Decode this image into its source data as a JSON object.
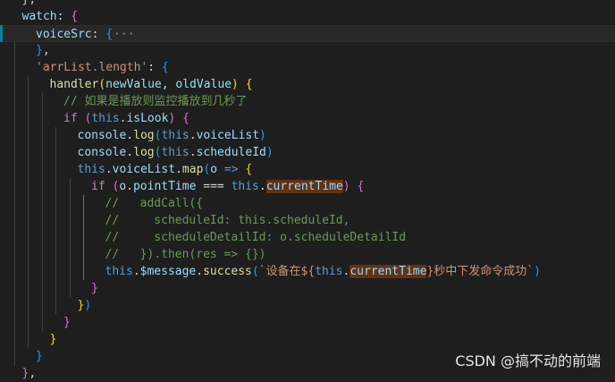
{
  "colors": {
    "background": "#1e1e1e",
    "current_line": "#282828",
    "modified_marker": "#0c7d9d",
    "word_highlight": "#613214"
  },
  "code_lines": [
    {
      "indent": 1,
      "segments": [
        {
          "t": "},",
          "c": "#d4d4d4"
        }
      ]
    },
    {
      "indent": 1,
      "segments": [
        {
          "t": "watch",
          "c": "#9cdcfe"
        },
        {
          "t": ": ",
          "c": "#d4d4d4"
        },
        {
          "t": "{",
          "c": "#da70d6"
        }
      ]
    },
    {
      "indent": 2,
      "current": true,
      "segments": [
        {
          "t": "voiceSrc",
          "c": "#9cdcfe"
        },
        {
          "t": ": ",
          "c": "#d4d4d4"
        },
        {
          "t": "{",
          "c": "#179fff"
        },
        {
          "t": "···",
          "c": "#8a8a8a",
          "fold": true
        }
      ]
    },
    {
      "indent": 2,
      "segments": [
        {
          "t": "}",
          "c": "#179fff"
        },
        {
          "t": ",",
          "c": "#d4d4d4"
        }
      ]
    },
    {
      "indent": 2,
      "segments": [
        {
          "t": "'arrList.length'",
          "c": "#ce9178"
        },
        {
          "t": ": ",
          "c": "#d4d4d4"
        },
        {
          "t": "{",
          "c": "#179fff"
        }
      ]
    },
    {
      "indent": 3,
      "segments": [
        {
          "t": "handler",
          "c": "#dcdcaa"
        },
        {
          "t": "(",
          "c": "#ffd700"
        },
        {
          "t": "newValue",
          "c": "#9cdcfe"
        },
        {
          "t": ", ",
          "c": "#d4d4d4"
        },
        {
          "t": "oldValue",
          "c": "#9cdcfe"
        },
        {
          "t": ")",
          "c": "#ffd700"
        },
        {
          "t": " ",
          "c": "#d4d4d4"
        },
        {
          "t": "{",
          "c": "#ffd700"
        }
      ]
    },
    {
      "indent": 4,
      "segments": [
        {
          "t": "// 如果是播放则监控播放到几秒了",
          "c": "#6a9955"
        }
      ]
    },
    {
      "indent": 4,
      "segments": [
        {
          "t": "if",
          "c": "#c586c0"
        },
        {
          "t": " ",
          "c": "#d4d4d4"
        },
        {
          "t": "(",
          "c": "#da70d6"
        },
        {
          "t": "this",
          "c": "#569cd6"
        },
        {
          "t": ".",
          "c": "#d4d4d4"
        },
        {
          "t": "isLook",
          "c": "#9cdcfe"
        },
        {
          "t": ")",
          "c": "#da70d6"
        },
        {
          "t": " ",
          "c": "#d4d4d4"
        },
        {
          "t": "{",
          "c": "#da70d6"
        }
      ]
    },
    {
      "indent": 5,
      "segments": [
        {
          "t": "console",
          "c": "#9cdcfe"
        },
        {
          "t": ".",
          "c": "#d4d4d4"
        },
        {
          "t": "log",
          "c": "#dcdcaa"
        },
        {
          "t": "(",
          "c": "#179fff"
        },
        {
          "t": "this",
          "c": "#569cd6"
        },
        {
          "t": ".",
          "c": "#d4d4d4"
        },
        {
          "t": "voiceList",
          "c": "#9cdcfe"
        },
        {
          "t": ")",
          "c": "#179fff"
        }
      ]
    },
    {
      "indent": 5,
      "segments": [
        {
          "t": "console",
          "c": "#9cdcfe"
        },
        {
          "t": ".",
          "c": "#d4d4d4"
        },
        {
          "t": "log",
          "c": "#dcdcaa"
        },
        {
          "t": "(",
          "c": "#179fff"
        },
        {
          "t": "this",
          "c": "#569cd6"
        },
        {
          "t": ".",
          "c": "#d4d4d4"
        },
        {
          "t": "scheduleId",
          "c": "#9cdcfe"
        },
        {
          "t": ")",
          "c": "#179fff"
        }
      ]
    },
    {
      "indent": 5,
      "segments": [
        {
          "t": "this",
          "c": "#569cd6"
        },
        {
          "t": ".",
          "c": "#d4d4d4"
        },
        {
          "t": "voiceList",
          "c": "#9cdcfe"
        },
        {
          "t": ".",
          "c": "#d4d4d4"
        },
        {
          "t": "map",
          "c": "#dcdcaa"
        },
        {
          "t": "(",
          "c": "#179fff"
        },
        {
          "t": "o",
          "c": "#9cdcfe"
        },
        {
          "t": " ",
          "c": "#d4d4d4"
        },
        {
          "t": "=>",
          "c": "#569cd6"
        },
        {
          "t": " ",
          "c": "#d4d4d4"
        },
        {
          "t": "{",
          "c": "#ffd700"
        }
      ]
    },
    {
      "indent": 6,
      "segments": [
        {
          "t": "if",
          "c": "#c586c0"
        },
        {
          "t": " ",
          "c": "#d4d4d4"
        },
        {
          "t": "(",
          "c": "#da70d6"
        },
        {
          "t": "o",
          "c": "#9cdcfe"
        },
        {
          "t": ".",
          "c": "#d4d4d4"
        },
        {
          "t": "pointTime",
          "c": "#9cdcfe"
        },
        {
          "t": " ",
          "c": "#d4d4d4"
        },
        {
          "t": "===",
          "c": "#d4d4d4"
        },
        {
          "t": " ",
          "c": "#d4d4d4"
        },
        {
          "t": "this",
          "c": "#569cd6"
        },
        {
          "t": ".",
          "c": "#d4d4d4"
        },
        {
          "t": "currentTime",
          "c": "#9cdcfe",
          "hl": true
        },
        {
          "t": ")",
          "c": "#da70d6"
        },
        {
          "t": " ",
          "c": "#d4d4d4"
        },
        {
          "t": "{",
          "c": "#da70d6"
        }
      ]
    },
    {
      "indent": 7,
      "segments": [
        {
          "t": "//   addCall({",
          "c": "#6a9955"
        }
      ]
    },
    {
      "indent": 7,
      "segments": [
        {
          "t": "//     scheduleId: this.scheduleId,",
          "c": "#6a9955"
        }
      ]
    },
    {
      "indent": 7,
      "segments": [
        {
          "t": "//     scheduleDetailId: o.scheduleDetailId",
          "c": "#6a9955"
        }
      ]
    },
    {
      "indent": 7,
      "segments": [
        {
          "t": "//   }).then(res => {})",
          "c": "#6a9955"
        }
      ]
    },
    {
      "indent": 7,
      "segments": [
        {
          "t": "this",
          "c": "#569cd6"
        },
        {
          "t": ".",
          "c": "#d4d4d4"
        },
        {
          "t": "$message",
          "c": "#9cdcfe"
        },
        {
          "t": ".",
          "c": "#d4d4d4"
        },
        {
          "t": "success",
          "c": "#dcdcaa"
        },
        {
          "t": "(",
          "c": "#179fff"
        },
        {
          "t": "`设备在${",
          "c": "#ce9178"
        },
        {
          "t": "this",
          "c": "#569cd6"
        },
        {
          "t": ".",
          "c": "#d4d4d4"
        },
        {
          "t": "currentTime",
          "c": "#9cdcfe",
          "hl": true
        },
        {
          "t": "}秒中下发命令成功`",
          "c": "#ce9178"
        },
        {
          "t": ")",
          "c": "#179fff"
        }
      ]
    },
    {
      "indent": 6,
      "segments": [
        {
          "t": "}",
          "c": "#da70d6"
        }
      ]
    },
    {
      "indent": 5,
      "segments": [
        {
          "t": "}",
          "c": "#ffd700"
        },
        {
          "t": ")",
          "c": "#179fff"
        }
      ]
    },
    {
      "indent": 4,
      "segments": [
        {
          "t": "}",
          "c": "#da70d6"
        }
      ]
    },
    {
      "indent": 3,
      "segments": [
        {
          "t": "}",
          "c": "#ffd700"
        }
      ]
    },
    {
      "indent": 2,
      "segments": [
        {
          "t": "}",
          "c": "#179fff"
        }
      ]
    },
    {
      "indent": 1,
      "segments": [
        {
          "t": "}",
          "c": "#da70d6"
        },
        {
          "t": ",",
          "c": "#d4d4d4"
        }
      ]
    }
  ],
  "watermark": "CSDN @搞不动的前端"
}
